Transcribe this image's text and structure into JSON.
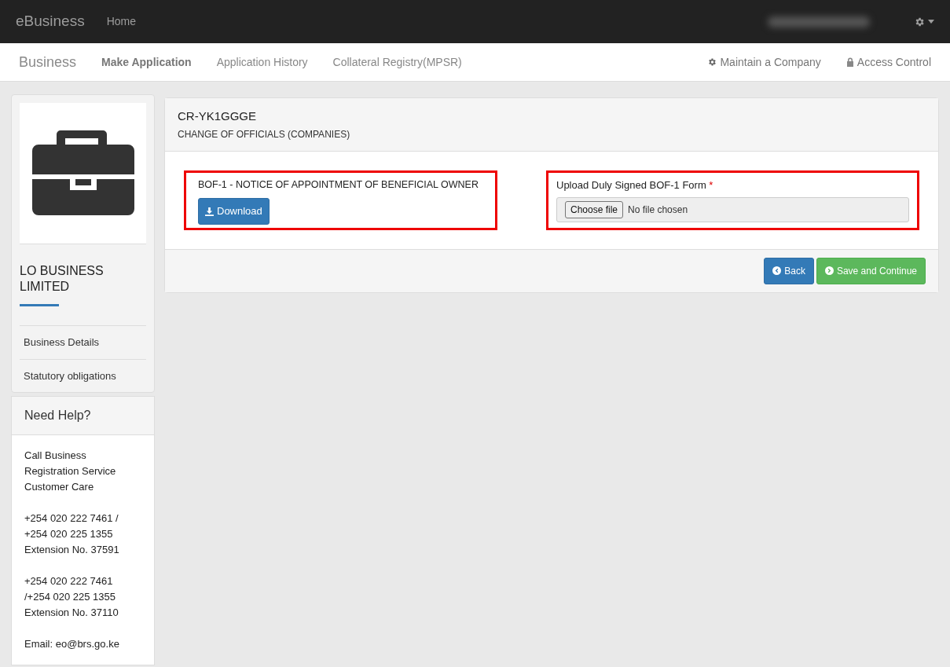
{
  "topbar": {
    "brand": "eBusiness",
    "links": [
      "Home"
    ]
  },
  "subnav": {
    "brand": "Business",
    "items": [
      {
        "label": "Make Application",
        "selected": true
      },
      {
        "label": "Application History",
        "selected": false
      },
      {
        "label": "Collateral Registry(MPSR)",
        "selected": false
      }
    ],
    "right_items": [
      {
        "label": "Maintain a Company",
        "kind": "gear"
      },
      {
        "label": "Access Control",
        "kind": "lock"
      }
    ]
  },
  "sidebar": {
    "company": "LO BUSINESS LIMITED",
    "items": [
      "Business Details",
      "Statutory obligations"
    ]
  },
  "help": {
    "title": "Need Help?",
    "paragraphs": [
      "Call Business Registration Service Customer Care",
      "+254 020 222 7461 /\n+254 020 225 1355\nExtension No. 37591",
      "+254 020 222 7461\n/+254 020 225 1355\nExtension No. 37110",
      "Email: eo@brs.go.ke"
    ]
  },
  "panel": {
    "title": "CR-YK1GGGE",
    "subtitle": "CHANGE OF OFFICIALS (COMPANIES)",
    "download": {
      "label": "BOF-1 - NOTICE OF APPOINTMENT OF BENEFICIAL OWNER",
      "button": "Download"
    },
    "upload": {
      "label": "Upload Duly Signed BOF-1 Form",
      "required": "*",
      "button": "Choose file",
      "status": "No file chosen"
    },
    "buttons": [
      {
        "label": "Back",
        "kind": "back"
      },
      {
        "label": "Save and Continue",
        "kind": "save"
      }
    ]
  }
}
